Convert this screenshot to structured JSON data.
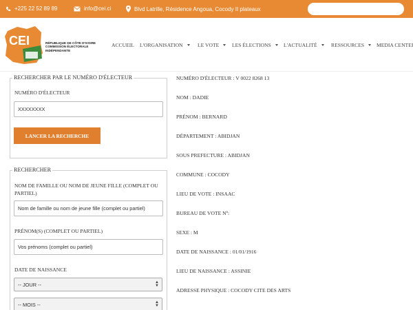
{
  "topbar": {
    "phone": "+225 22 52 89 89",
    "email": "info@cei.ci",
    "address": "Blvd Latrille, Résidence Angoua, Cocody II plateaux",
    "search_placeholder": ""
  },
  "logo": {
    "text": "CEI",
    "line1": "RÉPUBLIQUE DE CÔTE D'IVOIRE",
    "line2": "COMMISSION ÉLECTORALE",
    "line3": "INDÉPENDANTE"
  },
  "nav": {
    "items": [
      "ACCUEIL",
      "L'ORGANISATION",
      "LE VOTE",
      "LES ÉLECTIONS",
      "L'ACTUALITÉ",
      "RESSOURCES",
      "MEDIA CENTER"
    ]
  },
  "search_by_number": {
    "title": "RECHERCHER PAR LE NUMÉRO D'ÉLECTEUR",
    "number_label": "NUMÉRO D'ÉLECTEUR",
    "number_value": "XXXXXXXX",
    "button_label": "LANCER LA RECHERCHE"
  },
  "search_by_name": {
    "title": "RECHERCHER",
    "lastname_label": "NOM DE FAMILLE OU NOM DE JEUNE FILLE (COMPLET OU PARTIEL)",
    "lastname_placeholder": "Nom de famille ou nom de jeune fille (complet ou partiel)",
    "firstname_label": "PRÉNOM(S) (COMPLET OU PARTIEL)",
    "firstname_placeholder": "Vos prénoms  (complet ou partiel)",
    "birthdate_label": "DATE DE NAISSANCE",
    "day_selected": "-- JOUR --",
    "month_selected": "-- MOIS --"
  },
  "results": [
    "NUMÉRO D'ÉLECTEUR : V 0022 8268 13",
    "NOM : DADIE",
    "PRÉNOM : BERNARD",
    "DÉPARTEMENT : ABIDJAN",
    "SOUS PREFECTURE : ABIDJAN",
    "COMMUNE : COCODY",
    "LIEU DE VOTE : INSAAC",
    "BUREAU DE VOTE Nº:",
    "SEXE : M",
    "DATE DE NAISSANCE : 01/01/1916",
    "LIEU DE NAISSANCE : ASSINIE",
    "ADRESSE PHYSIQUE : COCODY CITE DES ARTS"
  ],
  "colors": {
    "brand_orange": "#e88a33",
    "button_orange": "#e07f2e",
    "logo_green": "#3d8b3d"
  }
}
